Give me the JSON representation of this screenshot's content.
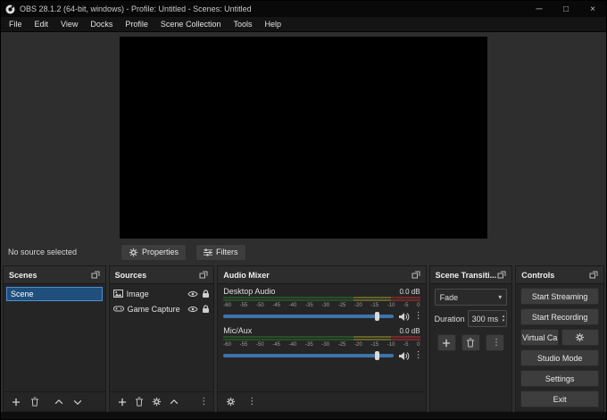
{
  "window": {
    "title": "OBS 28.1.2 (64-bit, windows) - Profile: Untitled - Scenes: Untitled",
    "controls": {
      "minimize": "─",
      "maximize": "□",
      "close": "×"
    }
  },
  "menu": {
    "items": [
      {
        "label": "File"
      },
      {
        "label": "Edit"
      },
      {
        "label": "View"
      },
      {
        "label": "Docks"
      },
      {
        "label": "Profile"
      },
      {
        "label": "Scene Collection"
      },
      {
        "label": "Tools"
      },
      {
        "label": "Help"
      }
    ]
  },
  "preview_toolbar": {
    "status": "No source selected",
    "properties_label": "Properties",
    "filters_label": "Filters"
  },
  "scenes": {
    "title": "Scenes",
    "items": [
      {
        "label": "Scene",
        "selected": true
      }
    ]
  },
  "sources": {
    "title": "Sources",
    "items": [
      {
        "label": "Image",
        "icon": "image-icon"
      },
      {
        "label": "Game Capture",
        "icon": "game-capture-icon"
      }
    ]
  },
  "mixer": {
    "title": "Audio Mixer",
    "channels": [
      {
        "name": "Desktop Audio",
        "level": "0.0 dB"
      },
      {
        "name": "Mic/Aux",
        "level": "0.0 dB"
      }
    ],
    "scale": [
      "-60",
      "-55",
      "-50",
      "-45",
      "-40",
      "-35",
      "-30",
      "-25",
      "-20",
      "-15",
      "-10",
      "-5",
      "0"
    ]
  },
  "transitions": {
    "title": "Scene Transiti...",
    "selected_transition": "Fade",
    "duration_label": "Duration",
    "duration_value": "300 ms"
  },
  "controls": {
    "title": "Controls",
    "buttons": {
      "start_streaming": "Start Streaming",
      "start_recording": "Start Recording",
      "virtual_cam": "rt Virtual Cam",
      "studio_mode": "Studio Mode",
      "settings": "Settings",
      "exit": "Exit"
    }
  },
  "colors": {
    "selection_bg": "#1f4f7c",
    "selection_border": "#4f8fd0",
    "slider_blue": "#3f74ab",
    "meter_green": "#265026",
    "meter_yellow": "#62622a",
    "meter_red": "#742a2a"
  },
  "glyphs": {
    "dots_vertical": "⋮",
    "combo_arrow": "▾",
    "spin_up": "▴",
    "spin_down": "▾"
  }
}
